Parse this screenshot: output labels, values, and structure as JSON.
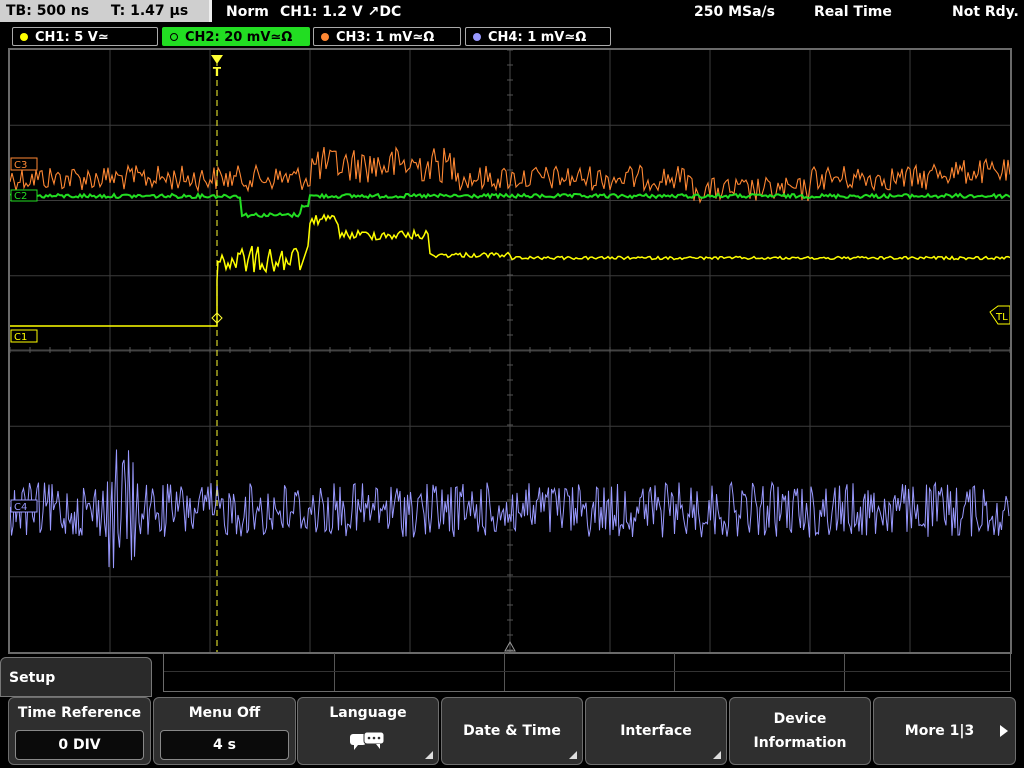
{
  "status": {
    "tb": "TB: 500 ns",
    "t": "T: 1.47 µs",
    "mode": "Norm",
    "trigger": "CH1: 1.2 V ↗DC",
    "rate": "250 MSa/s",
    "acq": "Real Time",
    "state": "Not Rdy."
  },
  "channels": [
    {
      "label": "CH1: 5 V≃",
      "color": "#ffff00"
    },
    {
      "label": "CH2: 20 mV≃Ω",
      "color": "#22dd22"
    },
    {
      "label": "CH3: 1 mV≃Ω",
      "color": "#ff8833"
    },
    {
      "label": "CH4: 1 mV≃Ω",
      "color": "#9999ff"
    }
  ],
  "markers": {
    "c1": "C1",
    "c2": "C2",
    "c3": "C3",
    "c4": "C4",
    "tl": "TL",
    "trig": "T"
  },
  "menu": {
    "title": "Setup",
    "time_reference_label": "Time Reference",
    "time_reference_value": "0 DIV",
    "menu_off_label": "Menu Off",
    "menu_off_value": "4 s",
    "language_label": "Language",
    "language_icon": "speech-bubble-icon",
    "date_time_label": "Date & Time",
    "interface_label": "Interface",
    "device_info_label_1": "Device",
    "device_info_label_2": "Information",
    "more_label": "More 1|3"
  }
}
